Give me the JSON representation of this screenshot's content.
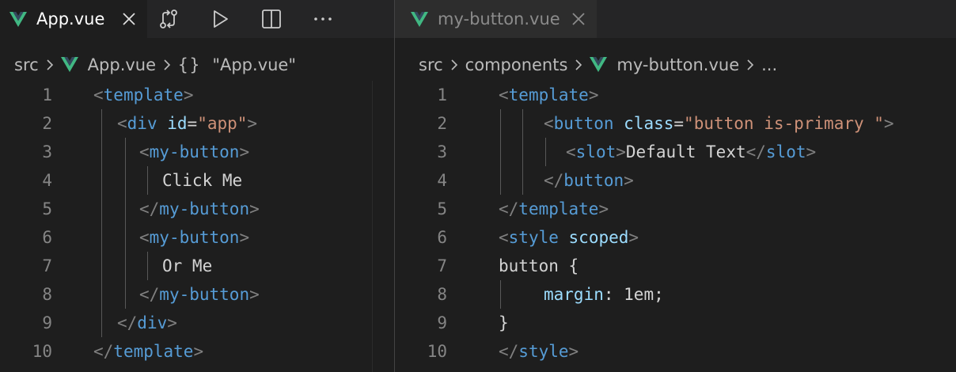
{
  "left_pane": {
    "tab": {
      "label": "App.vue"
    },
    "breadcrumb": {
      "folder": "src",
      "file": "App.vue",
      "symbol_glyph": "{}",
      "symbol": "\"App.vue\""
    },
    "lines": [
      {
        "n": "1",
        "indent": 0,
        "parts": [
          [
            "br",
            "<"
          ],
          [
            "tag",
            "template"
          ],
          [
            "br",
            ">"
          ]
        ]
      },
      {
        "n": "2",
        "indent": 1,
        "parts": [
          [
            "br",
            "<"
          ],
          [
            "tag",
            "div"
          ],
          [
            "plain",
            " "
          ],
          [
            "attr",
            "id"
          ],
          [
            "plain",
            "="
          ],
          [
            "str",
            "\"app\""
          ],
          [
            "br",
            ">"
          ]
        ]
      },
      {
        "n": "3",
        "indent": 2,
        "parts": [
          [
            "br",
            "<"
          ],
          [
            "tag",
            "my-button"
          ],
          [
            "br",
            ">"
          ]
        ]
      },
      {
        "n": "4",
        "indent": 3,
        "parts": [
          [
            "plain",
            "Click Me"
          ]
        ]
      },
      {
        "n": "5",
        "indent": 2,
        "parts": [
          [
            "br",
            "</"
          ],
          [
            "tag",
            "my-button"
          ],
          [
            "br",
            ">"
          ]
        ]
      },
      {
        "n": "6",
        "indent": 2,
        "parts": [
          [
            "br",
            "<"
          ],
          [
            "tag",
            "my-button"
          ],
          [
            "br",
            ">"
          ]
        ]
      },
      {
        "n": "7",
        "indent": 3,
        "parts": [
          [
            "plain",
            "Or Me"
          ]
        ]
      },
      {
        "n": "8",
        "indent": 2,
        "parts": [
          [
            "br",
            "</"
          ],
          [
            "tag",
            "my-button"
          ],
          [
            "br",
            ">"
          ]
        ]
      },
      {
        "n": "9",
        "indent": 1,
        "parts": [
          [
            "br",
            "</"
          ],
          [
            "tag",
            "div"
          ],
          [
            "br",
            ">"
          ]
        ]
      },
      {
        "n": "10",
        "indent": 0,
        "parts": [
          [
            "br",
            "</"
          ],
          [
            "tag",
            "template"
          ],
          [
            "br",
            ">"
          ]
        ]
      }
    ]
  },
  "right_pane": {
    "tab": {
      "label": "my-button.vue"
    },
    "breadcrumb": {
      "folder": "src",
      "subfolder": "components",
      "file": "my-button.vue",
      "more": "..."
    },
    "lines": [
      {
        "n": "1",
        "indent": 0,
        "parts": [
          [
            "br",
            "<"
          ],
          [
            "tag",
            "template"
          ],
          [
            "br",
            ">"
          ]
        ]
      },
      {
        "n": "2",
        "indent": 2,
        "parts": [
          [
            "br",
            "<"
          ],
          [
            "tag",
            "button"
          ],
          [
            "plain",
            " "
          ],
          [
            "attr",
            "class"
          ],
          [
            "plain",
            "="
          ],
          [
            "str",
            "\"button is-primary \""
          ],
          [
            "br",
            ">"
          ]
        ]
      },
      {
        "n": "3",
        "indent": 3,
        "parts": [
          [
            "br",
            "<"
          ],
          [
            "tag",
            "slot"
          ],
          [
            "br",
            ">"
          ],
          [
            "plain",
            "Default Text"
          ],
          [
            "br",
            "</"
          ],
          [
            "tag",
            "slot"
          ],
          [
            "br",
            ">"
          ]
        ]
      },
      {
        "n": "4",
        "indent": 2,
        "parts": [
          [
            "br",
            "</"
          ],
          [
            "tag",
            "button"
          ],
          [
            "br",
            ">"
          ]
        ]
      },
      {
        "n": "5",
        "indent": 0,
        "parts": [
          [
            "br",
            "</"
          ],
          [
            "tag",
            "template"
          ],
          [
            "br",
            ">"
          ]
        ]
      },
      {
        "n": "6",
        "indent": 0,
        "parts": [
          [
            "br",
            "<"
          ],
          [
            "tag",
            "style"
          ],
          [
            "plain",
            " "
          ],
          [
            "attr",
            "scoped"
          ],
          [
            "br",
            ">"
          ]
        ]
      },
      {
        "n": "7",
        "indent": 0,
        "parts": [
          [
            "plain",
            "button {"
          ]
        ]
      },
      {
        "n": "8",
        "indent": 1,
        "parts": [
          [
            "attr",
            "margin"
          ],
          [
            "plain",
            ": "
          ],
          [
            "plain",
            "1em"
          ],
          [
            "plain",
            ";"
          ]
        ]
      },
      {
        "n": "9",
        "indent": 0,
        "parts": [
          [
            "plain",
            "}"
          ]
        ]
      },
      {
        "n": "10",
        "indent": 0,
        "parts": [
          [
            "br",
            "</"
          ],
          [
            "tag",
            "style"
          ],
          [
            "br",
            ">"
          ]
        ]
      }
    ]
  },
  "icons": {
    "vue_logo": "vue-logo-icon",
    "close": "close-icon",
    "compare_changes": "git-compare-icon",
    "run": "play-icon",
    "split_editor": "split-editor-icon",
    "more_actions": "ellipsis-icon"
  },
  "colors": {
    "vue": "#41b883",
    "tag": "#569cd6",
    "bracket": "#808080",
    "attribute": "#9cdcfe",
    "string": "#ce9178",
    "text": "#d4d4d4"
  }
}
